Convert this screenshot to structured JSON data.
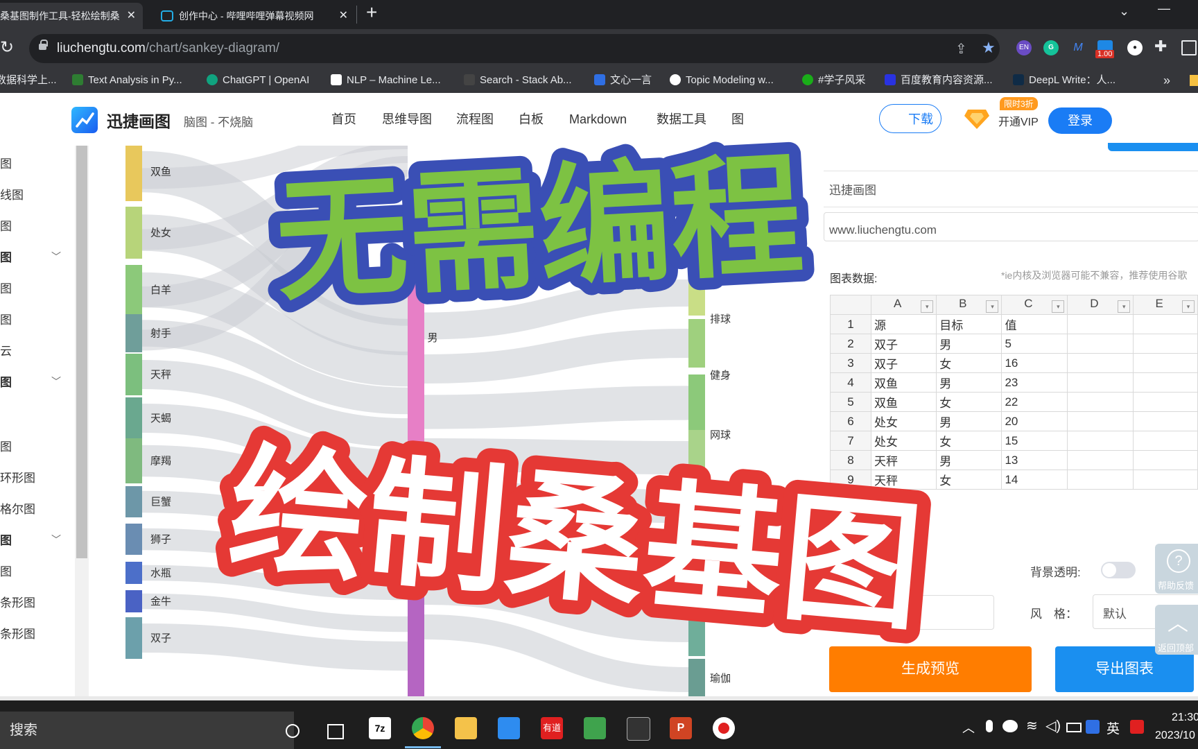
{
  "browser": {
    "tabs": [
      {
        "title": "桑基图制作工具-轻松绘制桑"
      },
      {
        "title": "创作中心 - 哔哩哔哩弹幕视频网"
      }
    ],
    "new_tab_symbol": "+",
    "url_host": "liuchengtu.com",
    "url_path": "/chart/sankey-diagram/",
    "zoom_badge": "1.00",
    "extension_en": "EN",
    "bookmarks": [
      "数据科学上...",
      "Text Analysis in Py...",
      "ChatGPT | OpenAI",
      "NLP – Machine Le...",
      "Search - Stack Ab...",
      "文心一言",
      "Topic Modeling w...",
      "#学子风采",
      "百度教育内容资源...",
      "DeepL Write：人..."
    ],
    "more_symbol": "»"
  },
  "site": {
    "logo": "迅捷画图",
    "slogan": "脑图 - 不烧脑",
    "nav": [
      "首页",
      "思维导图",
      "流程图",
      "白板",
      "Markdown",
      "数据工具",
      "图"
    ],
    "download": "下载",
    "vip_badge": "限时3折",
    "vip": "开通VIP",
    "login": "登录"
  },
  "sidebar": [
    {
      "label": "图"
    },
    {
      "label": "线图"
    },
    {
      "label": "图"
    },
    {
      "label": "图",
      "bold": true,
      "expand": true
    },
    {
      "label": "图"
    },
    {
      "label": "图"
    },
    {
      "label": "云"
    },
    {
      "label": "图",
      "bold": true,
      "expand": true
    },
    {
      "label": "图"
    },
    {
      "label": "环形图"
    },
    {
      "label": "格尔图"
    },
    {
      "label": "图",
      "bold": true,
      "expand": true
    },
    {
      "label": "图"
    },
    {
      "label": "条形图"
    },
    {
      "label": "条形图"
    }
  ],
  "chart_data": {
    "type": "sankey",
    "left_nodes": [
      "双鱼",
      "处女",
      "白羊",
      "射手",
      "天秤",
      "天蝎",
      "摩羯",
      "巨蟹",
      "狮子",
      "水瓶",
      "金牛",
      "双子"
    ],
    "middle_nodes": [
      "男"
    ],
    "right_nodes": [
      "排球",
      "健身",
      "网球",
      "瑜伽"
    ]
  },
  "panel": {
    "title_value": "迅捷画图",
    "url_value": "www.liuchengtu.com",
    "data_label": "图表数据:",
    "note": "*ie内核及浏览器可能不兼容，推荐使用谷歌",
    "columns": [
      "A",
      "B",
      "C",
      "D",
      "E"
    ],
    "filter_symbol": "▾",
    "rows": [
      [
        "1",
        "源",
        "目标",
        "值",
        "",
        ""
      ],
      [
        "2",
        "双子",
        "男",
        "5",
        "",
        ""
      ],
      [
        "3",
        "双子",
        "女",
        "16",
        "",
        ""
      ],
      [
        "4",
        "双鱼",
        "男",
        "23",
        "",
        ""
      ],
      [
        "5",
        "双鱼",
        "女",
        "22",
        "",
        ""
      ],
      [
        "6",
        "处女",
        "男",
        "20",
        "",
        ""
      ],
      [
        "7",
        "处女",
        "女",
        "15",
        "",
        ""
      ],
      [
        "8",
        "天秤",
        "男",
        "13",
        "",
        ""
      ],
      [
        "9",
        "天秤",
        "女",
        "14",
        "",
        ""
      ]
    ],
    "bg_transparent_label": "背景透明:",
    "style_label": "风　格：",
    "style_value": "默认",
    "preview_button": "生成预览",
    "export_button": "导出图表",
    "help_label": "帮助反馈",
    "help_symbol": "?",
    "top_label": "返回顶部",
    "top_symbol": "︿"
  },
  "overlay": {
    "line1": "无需编程",
    "line2": "绘制桑基图"
  },
  "taskbar": {
    "search": "搜索",
    "app_7z": "7z",
    "app_youdao": "有道",
    "ime": "英",
    "time": "21:30",
    "date": "2023/10"
  },
  "colors": {
    "overlay1_fill": "#7dc243",
    "overlay1_stroke": "#3a4fb5",
    "overlay2_fill": "#ffffff",
    "overlay2_stroke": "#e53935",
    "login": "#1a7cf5",
    "preview": "#ff7d00",
    "export": "#1a8ff0"
  }
}
